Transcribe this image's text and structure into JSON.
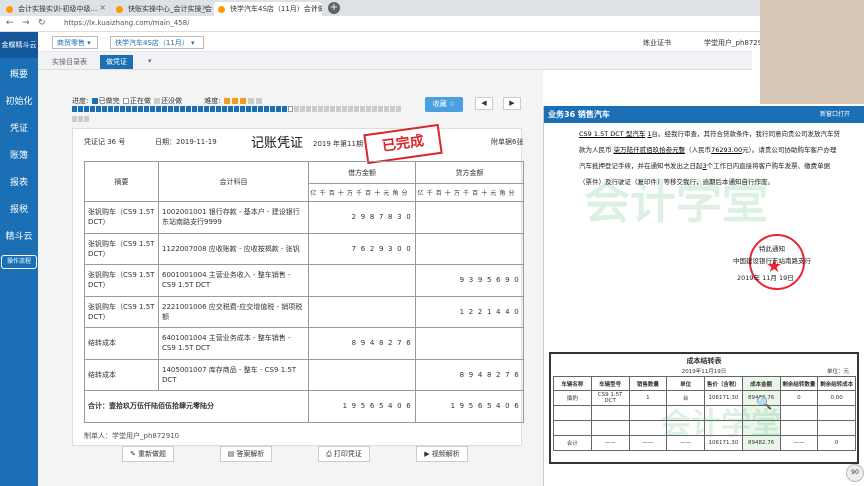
{
  "browser": {
    "tabs": [
      {
        "label": "会计实操实训-初级中级...",
        "active": false
      },
      {
        "label": "快账实操中心_会计实操_会计做账...",
        "active": false
      },
      {
        "label": "快学汽车4S店（11月）会计做账...",
        "active": true
      }
    ],
    "url": "https://lx.kuaizhang.com/main_458/"
  },
  "sidebar": {
    "logo": "金蝶精斗云",
    "items": [
      "概要",
      "初始化",
      "凭证",
      "账簿",
      "报表",
      "报税",
      "精斗云"
    ],
    "flow_button": "操作流程"
  },
  "topbar": {
    "industry_select": "商贸零售",
    "company_select": "快学汽车4S店（11月）",
    "cert_label": "练业证书",
    "user": "学堂用户_ph872910"
  },
  "page_tabs": {
    "items": [
      "实操目录表",
      "做凭证"
    ],
    "active_index": 1
  },
  "progress": {
    "label": "进度:",
    "done": "已做完",
    "doing": "正在做",
    "todo": "还没做",
    "difficulty_label": "难度:",
    "stars": 3,
    "max_stars": 5,
    "favorite_button": "收藏 ☆",
    "prev": "◀",
    "next": "▶",
    "done_count": 36,
    "total_count": 58
  },
  "voucher": {
    "voucher_no": "凭证记 36 号",
    "date": "日期：2019-11-19",
    "title": "记账凭证",
    "period": "2019 年第11期",
    "attachments": "附单据6张",
    "stamp": "已完成",
    "col_summary": "摘要",
    "col_account": "会计科目",
    "col_debit": "借方金额",
    "col_credit": "贷方金额",
    "digit_headers": [
      "亿",
      "千",
      "百",
      "十",
      "万",
      "千",
      "百",
      "十",
      "元",
      "角",
      "分"
    ],
    "entries": [
      {
        "summary": "张钒购车（CS9 1.5T DCT）",
        "account": "1002001001 银行存款 - 基本户 - 建设银行东站南路支行9999",
        "debit": "2987830",
        "credit": ""
      },
      {
        "summary": "张钒购车（CS9 1.5T DCT）",
        "account": "1122007008 应收账款 - 应收按揭款 - 张钒",
        "debit": "7629300",
        "credit": ""
      },
      {
        "summary": "张钒购车（CS9 1.5T DCT）",
        "account": "6001001004 主营业务收入 - 整车销售 - CS9 1.5T DCT",
        "debit": "",
        "credit": "9395690"
      },
      {
        "summary": "张钒购车（CS9 1.5T DCT）",
        "account": "2221001006 应交税费-应交增值税 - 销项税额",
        "debit": "",
        "credit": "1221440"
      },
      {
        "summary": "结转成本",
        "account": "6401001004 主营业务成本 - 整车销售 - CS9 1.5T DCT",
        "debit": "8948276",
        "credit": ""
      },
      {
        "summary": "结转成本",
        "account": "1405001007 库存商品 - 整车 - CS9 1.5T DCT",
        "debit": "",
        "credit": "8948276"
      }
    ],
    "total_label": "合计：壹拾玖万伍仟陆佰伍拾肆元零陆分",
    "total_debit": "19565406",
    "total_credit": "19565406",
    "maker": "制单人：学堂用户_ph872910"
  },
  "actions": {
    "redo": "重新做题",
    "answer": "答案解析",
    "print": "打印凭证",
    "video": "视频解析"
  },
  "panel": {
    "title": "业务36 销售汽车",
    "open_new": "新窗口打开",
    "para1_a": "CS9 1.5T DCT 型汽车",
    "para1_qty": "1",
    "para1_b": "台。经我行审查，其符合贷款条件，我行同意向贵公司发放汽车贷款为人民币",
    "para1_amount_cn": "柒万陆仟贰佰玖拾叁元整",
    "para1_c": "（人民币",
    "para1_amount": "76293.00",
    "para1_d": "元）。请贵公司协助购车客户办理汽车抵押登记手续，并在通知书发出之日起",
    "para1_days": "3",
    "para1_e": "个工作日内直接将客户购车发票、缴费单据（票件）及行驶证（复印件）等移交我行，逾期后本通知自行作废。",
    "notice_label": "特此通知",
    "bank": "中国建设银行东站南路支行",
    "notice_date": "2019年 11月 19日",
    "watermark": "会计学堂",
    "cost_table": {
      "title": "成本结转表",
      "date": "2019年11月19日",
      "unit": "单位：元",
      "headers": [
        "车辆名称",
        "车辆型号",
        "销售数量",
        "单位",
        "售价（含税）",
        "成本金额",
        "剩余结转数量",
        "剩余结转成本"
      ],
      "rows": [
        [
          "撬豹",
          "CS9 1.5T DCT",
          "1",
          "台",
          "106171.30",
          "89482.76",
          "0",
          "0.00"
        ]
      ],
      "total": [
        "合计",
        "——",
        "——",
        "——",
        "106171.30",
        "89482.76",
        "——",
        "0"
      ]
    },
    "zoom": "90"
  }
}
